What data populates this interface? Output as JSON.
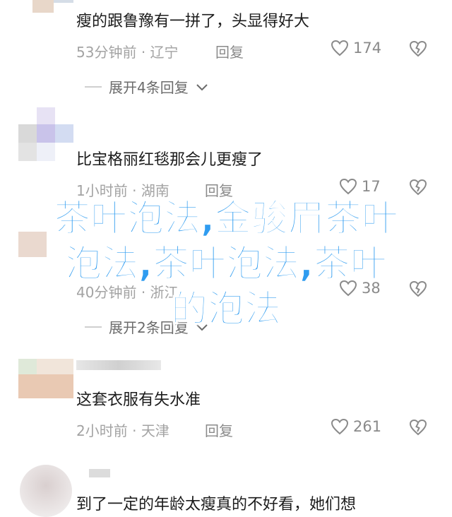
{
  "comments": [
    {
      "text": "瘦的跟鲁豫有一拼了，头显得好大",
      "time": "53分钟前",
      "location": "辽宁",
      "reply": "回复",
      "likes": "174"
    },
    {
      "text": "比宝格丽红毯那会儿更瘦了",
      "time": "1小时前",
      "location": "湖南",
      "reply": "回复",
      "likes": "17"
    },
    {
      "time": "40分钟前",
      "location": "浙江",
      "likes": "38"
    },
    {
      "text": "这套衣服有失水准",
      "time": "2小时前",
      "location": "天津",
      "reply": "回复",
      "likes": "261"
    },
    {
      "text": "到了一定的年龄太瘦真的不好看，她们想"
    }
  ],
  "expand": [
    {
      "label": "展开4条回复"
    },
    {
      "label": "展开2条回复"
    }
  ],
  "overlay": {
    "line1": "茶叶泡法,金骏眉茶叶",
    "line2": "泡法,茶叶泡法,茶叶",
    "line3": "的泡法"
  },
  "colors": {
    "overlay_text": "#2f9cf0",
    "meta": "#a3a3a3",
    "icon": "#8a8a8a"
  }
}
